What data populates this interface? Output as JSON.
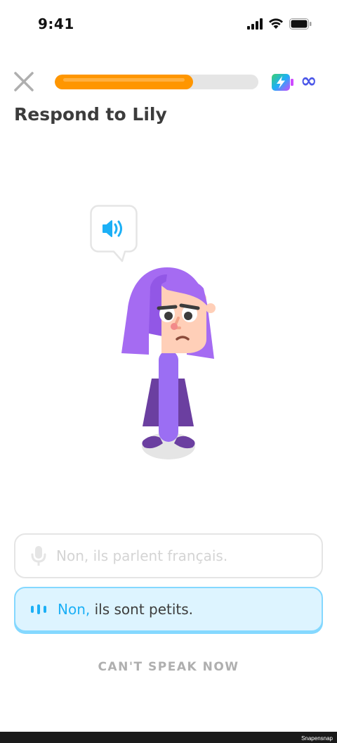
{
  "status": {
    "time": "9:41"
  },
  "header": {
    "title": "Respond to Lily",
    "energy_label": "∞",
    "progress": 0.68
  },
  "options": [
    {
      "text": "Non, ils parlent français."
    },
    {
      "highlight": "Non,",
      "text": " ils sont petits."
    }
  ],
  "footer": {
    "cant_speak": "CAN'T SPEAK NOW",
    "watermark": "Snapensnap"
  },
  "colors": {
    "progress": "#ff9600",
    "accent_blue": "#1cb0f6",
    "hair": "#a56bf2",
    "dress": "#6b3fa0"
  },
  "icons": [
    "close-icon",
    "energy-icon",
    "speaker-icon",
    "microphone-icon",
    "sound-wave-icon",
    "signal-icon",
    "wifi-icon",
    "battery-icon"
  ]
}
